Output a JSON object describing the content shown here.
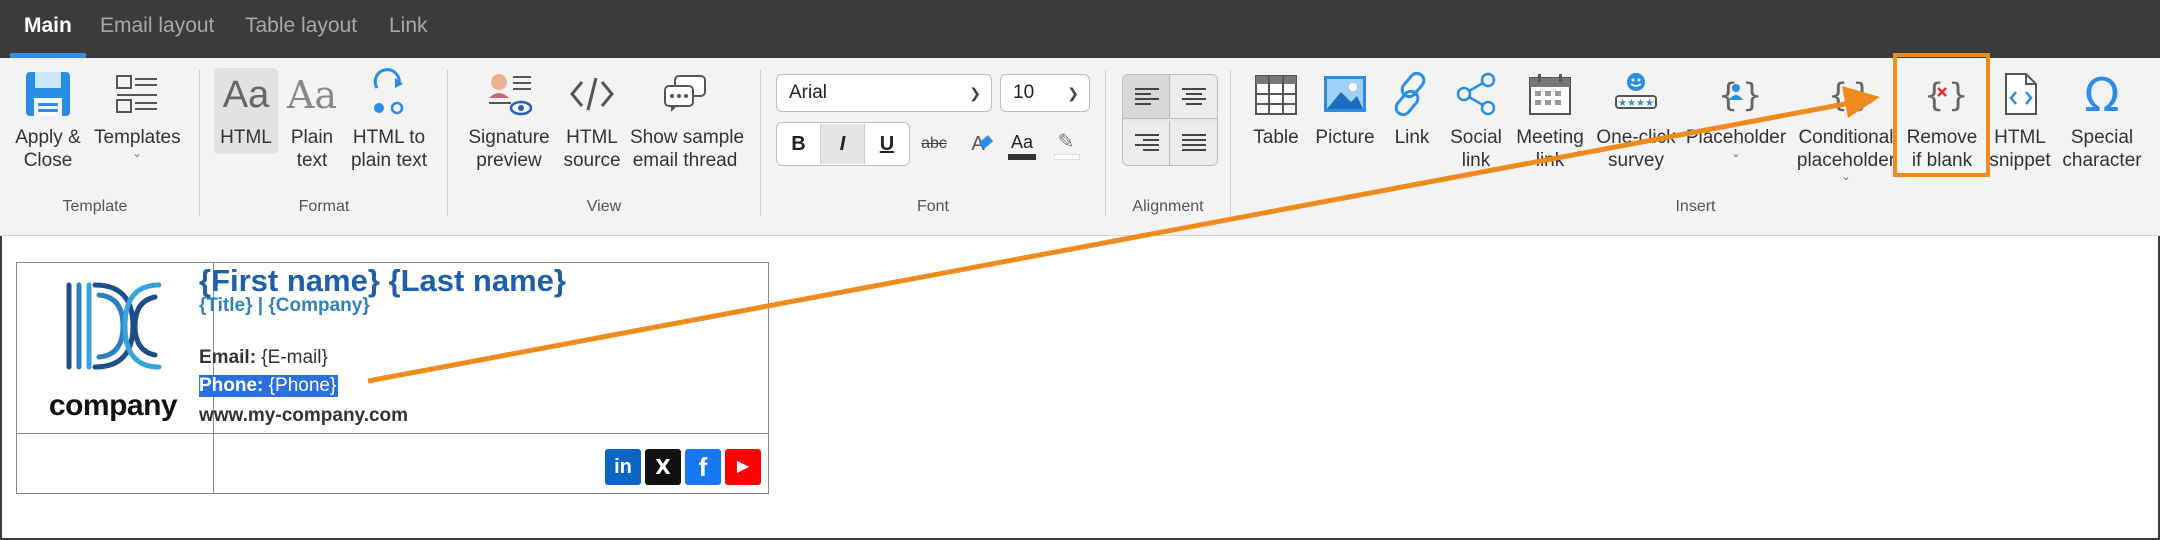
{
  "tabs": [
    {
      "label": "Main",
      "active": true
    },
    {
      "label": "Email layout",
      "active": false
    },
    {
      "label": "Table layout",
      "active": false
    },
    {
      "label": "Link",
      "active": false
    }
  ],
  "ribbon": {
    "template": {
      "group_label": "Template",
      "apply_close": "Apply &\nClose",
      "templates": "Templates"
    },
    "format": {
      "group_label": "Format",
      "html": "HTML",
      "plain_text": "Plain\ntext",
      "html_to_plain": "HTML to\nplain text",
      "aa_glyph": "Aa"
    },
    "view": {
      "group_label": "View",
      "signature_preview": "Signature\npreview",
      "html_source": "HTML\nsource",
      "show_sample": "Show sample\nemail thread"
    },
    "font": {
      "group_label": "Font",
      "family": "Arial",
      "size": "10",
      "bold": "B",
      "italic": "I",
      "underline": "U",
      "strike": "abc",
      "clear_glyph": "A",
      "color_glyph": "Aa"
    },
    "alignment": {
      "group_label": "Alignment"
    },
    "insert": {
      "group_label": "Insert",
      "table": "Table",
      "picture": "Picture",
      "link": "Link",
      "social_link": "Social\nlink",
      "meeting_link": "Meeting\nlink",
      "one_click_survey": "One-click\nsurvey",
      "placeholder": "Placeholder",
      "conditional_placeholder": "Conditional\nplaceholder",
      "remove_if_blank": "Remove\nif blank",
      "html_snippet": "HTML\nsnippet",
      "special_character": "Special\ncharacter"
    }
  },
  "signature": {
    "logo_text": "company",
    "name": "{First name} {Last name}",
    "title_company": "{Title} | {Company}",
    "email_label": "Email:",
    "email_value": " {E-mail}",
    "phone_label": "Phone:",
    "phone_value": " {Phone}",
    "website": "www.my-company.com",
    "social": [
      {
        "name": "linkedin",
        "glyph": "in",
        "color": "#0a66c2"
      },
      {
        "name": "x",
        "glyph": "X",
        "color": "#111111"
      },
      {
        "name": "facebook",
        "glyph": "f",
        "color": "#1877f2"
      },
      {
        "name": "youtube",
        "glyph": "▶",
        "color": "#ff0000"
      }
    ]
  },
  "colors": {
    "highlight": "#f08a1c",
    "accent_tab": "#2f8fe6",
    "selection": "#2a6fdc",
    "name_blue": "#1f5ea8"
  }
}
